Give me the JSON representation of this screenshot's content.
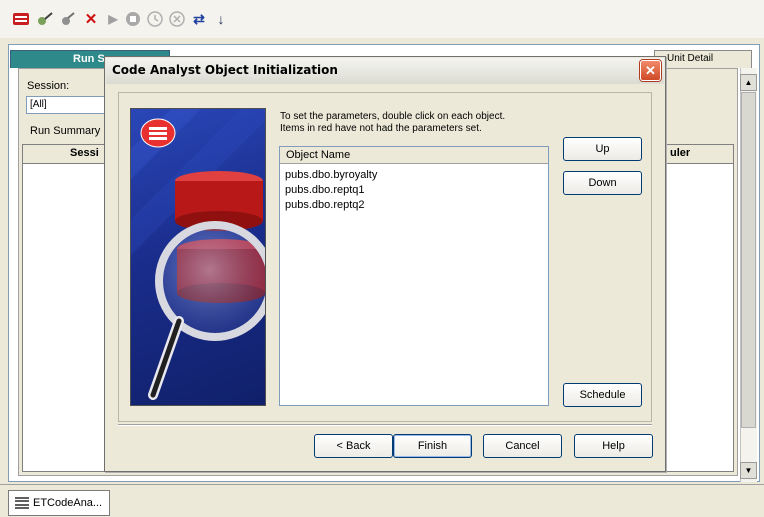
{
  "toolbar": {
    "icons": [
      "app-icon",
      "connect-icon",
      "disconnect-icon",
      "delete-icon",
      "run-icon",
      "stop-icon",
      "pause-icon",
      "cancel-icon",
      "refresh-icon",
      "sort-icon"
    ]
  },
  "main": {
    "tab_run_summary": "Run Sur",
    "tab_unit_detail": "Unit Detail",
    "session_label": "Session:",
    "session_value": "[All]",
    "run_summary_label": "Run Summary",
    "column_session": "Sessi",
    "column_scheduler": "uler"
  },
  "dialog": {
    "title": "Code Analyst Object Initialization",
    "instruction_line1": "To set the parameters, double click on each object.",
    "instruction_line2": "Items in red have not had the parameters set.",
    "list_header": "Object Name",
    "objects": [
      "pubs.dbo.byroyalty",
      "pubs.dbo.reptq1",
      "pubs.dbo.reptq2"
    ],
    "up_label": "Up",
    "down_label": "Down",
    "schedule_label": "Schedule",
    "back_label": "< Back",
    "finish_label": "Finish",
    "cancel_label": "Cancel",
    "help_label": "Help",
    "close_glyph": "✕"
  },
  "taskbar": {
    "tab_label": "ETCodeAna..."
  },
  "colors": {
    "tab_active": "#2e8a8a",
    "art_blue": "#1a2d8c",
    "disk_red": "#d02020",
    "close_red": "#d04a28"
  }
}
